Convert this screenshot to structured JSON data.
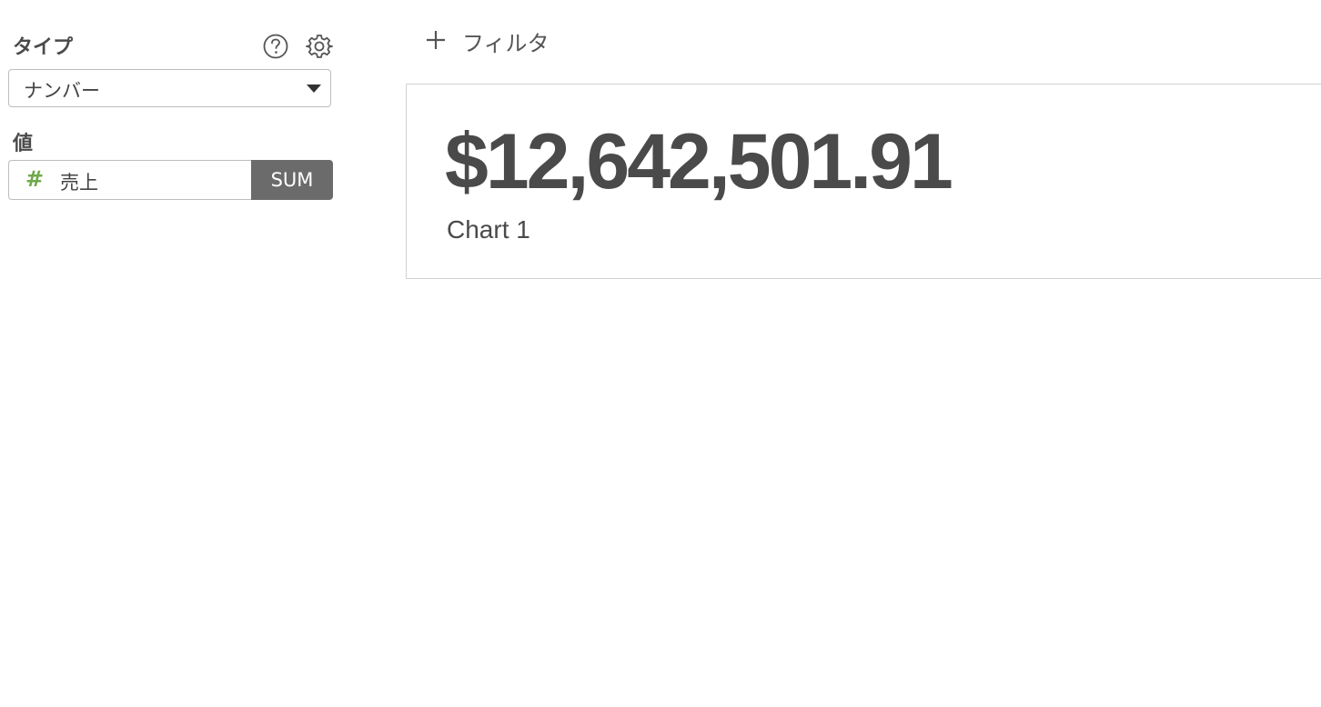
{
  "sidebar": {
    "type_label": "タイプ",
    "type_select": {
      "selected": "ナンバー"
    },
    "value_label": "値",
    "value_field": {
      "type_symbol": "#",
      "name": "売上",
      "aggregation": "SUM"
    },
    "icons": {
      "help": "help-circle-icon",
      "settings": "gear-icon"
    }
  },
  "toolbar": {
    "filter_label": "フィルタ"
  },
  "card": {
    "value": "$12,642,501.91",
    "title": "Chart 1"
  },
  "colors": {
    "accent_green": "#6fa84b",
    "agg_button_bg": "#6b6b6b",
    "text": "#4a4a4a"
  }
}
